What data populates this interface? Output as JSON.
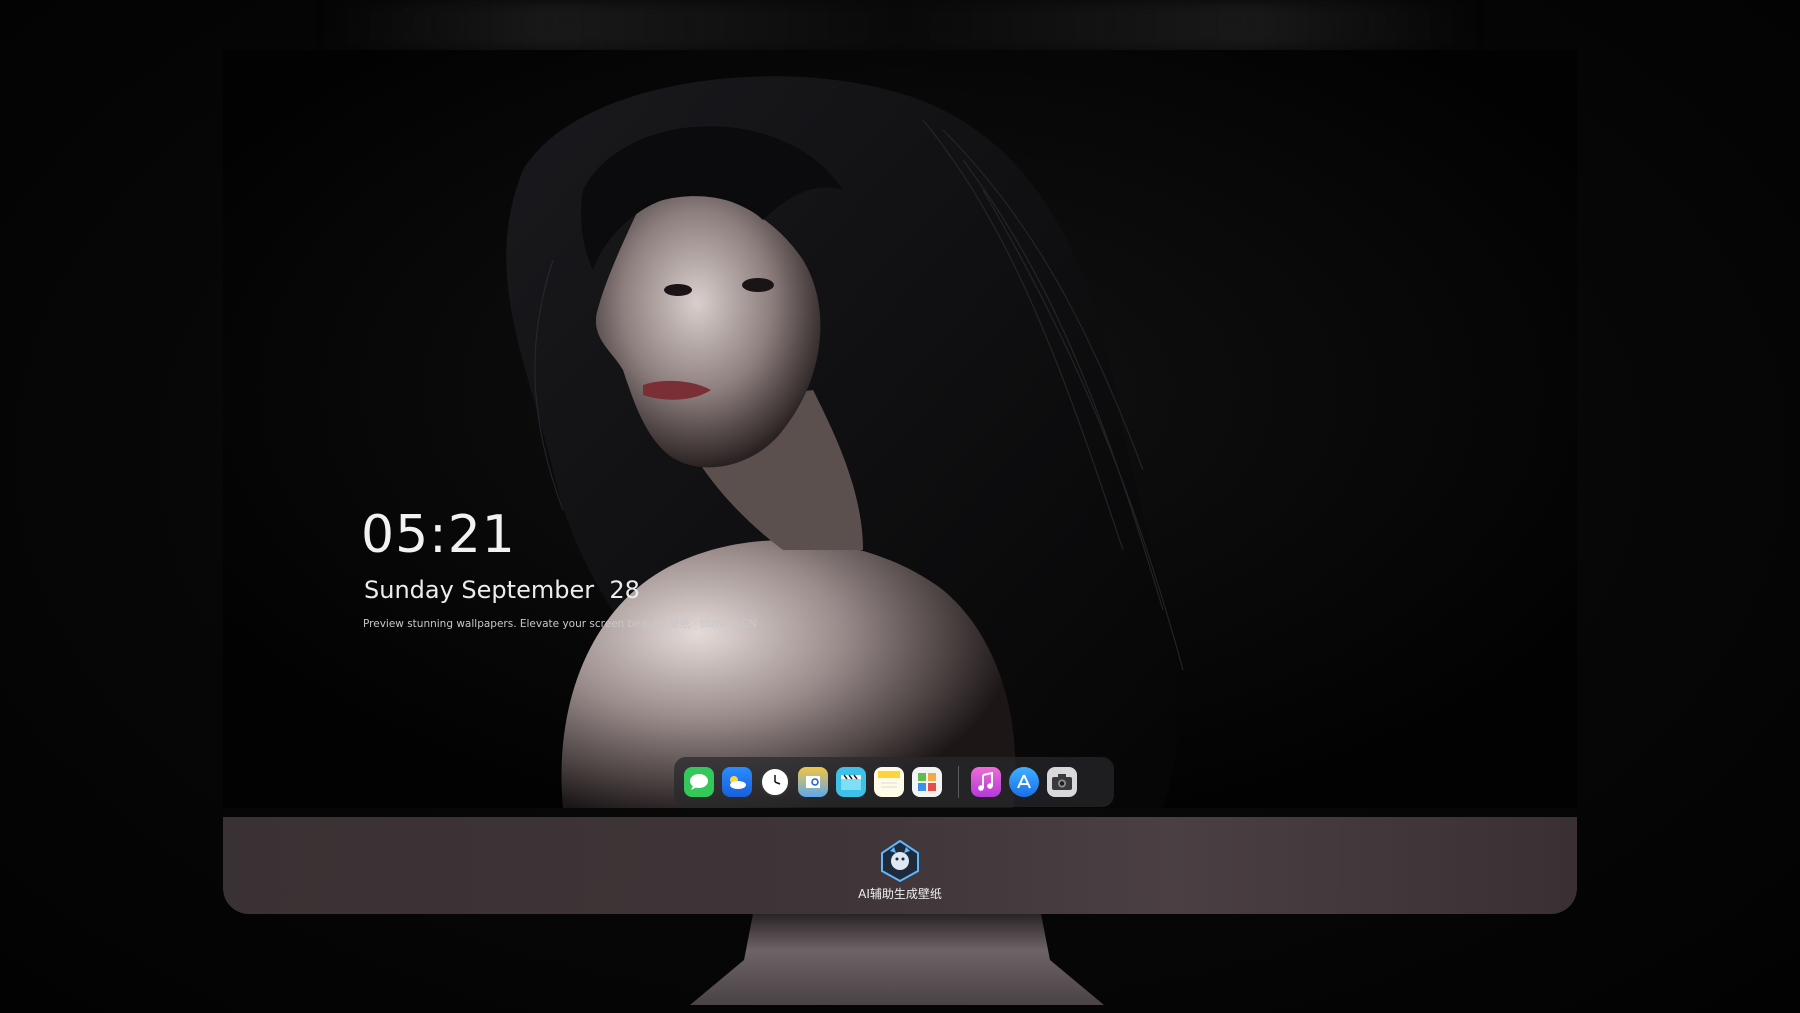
{
  "lock_screen": {
    "time": "05:21",
    "date": "Sunday September  28",
    "tagline": "Preview stunning wallpapers. Elevate your screen beauty. 壁纸 · bizhimi.CN"
  },
  "dock": {
    "apps": [
      {
        "icon": "messages-icon",
        "color": "#34c759"
      },
      {
        "icon": "weather-icon",
        "color": "#1e90ff"
      },
      {
        "icon": "clock-icon",
        "color": "#ffffff"
      },
      {
        "icon": "preview-icon",
        "color": "#f4c542"
      },
      {
        "icon": "clips-icon",
        "color": "#3ec1e8"
      },
      {
        "icon": "notes-icon",
        "color": "#ffd43b"
      },
      {
        "icon": "photo-booth-icon",
        "color": "#5fbf4a"
      },
      {
        "icon": "music-icon",
        "color": "#e94bd1"
      },
      {
        "icon": "app-store-icon",
        "color": "#1a8cff"
      },
      {
        "icon": "camera-icon",
        "color": "#8e8e93"
      }
    ]
  },
  "chin": {
    "label": "AI辅助生成壁纸"
  }
}
